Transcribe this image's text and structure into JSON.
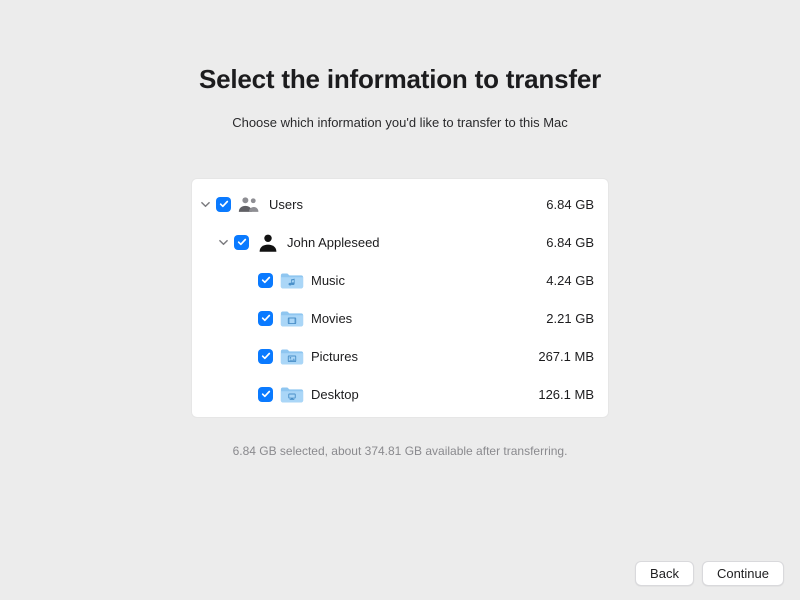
{
  "title": "Select the information to transfer",
  "subtitle": "Choose which information you'd like to transfer to this Mac",
  "tree": {
    "root": {
      "label": "Users",
      "size": "6.84 GB",
      "checked": true,
      "expanded": true
    },
    "user": {
      "label": "John Appleseed",
      "size": "6.84 GB",
      "checked": true,
      "expanded": true
    },
    "items": [
      {
        "label": "Music",
        "size": "4.24 GB",
        "checked": true,
        "icon": "music"
      },
      {
        "label": "Movies",
        "size": "2.21 GB",
        "checked": true,
        "icon": "movies"
      },
      {
        "label": "Pictures",
        "size": "267.1 MB",
        "checked": true,
        "icon": "pictures"
      },
      {
        "label": "Desktop",
        "size": "126.1 MB",
        "checked": true,
        "icon": "desktop"
      }
    ]
  },
  "status": "6.84 GB selected, about 374.81 GB available after transferring.",
  "buttons": {
    "back": "Back",
    "continue": "Continue"
  }
}
